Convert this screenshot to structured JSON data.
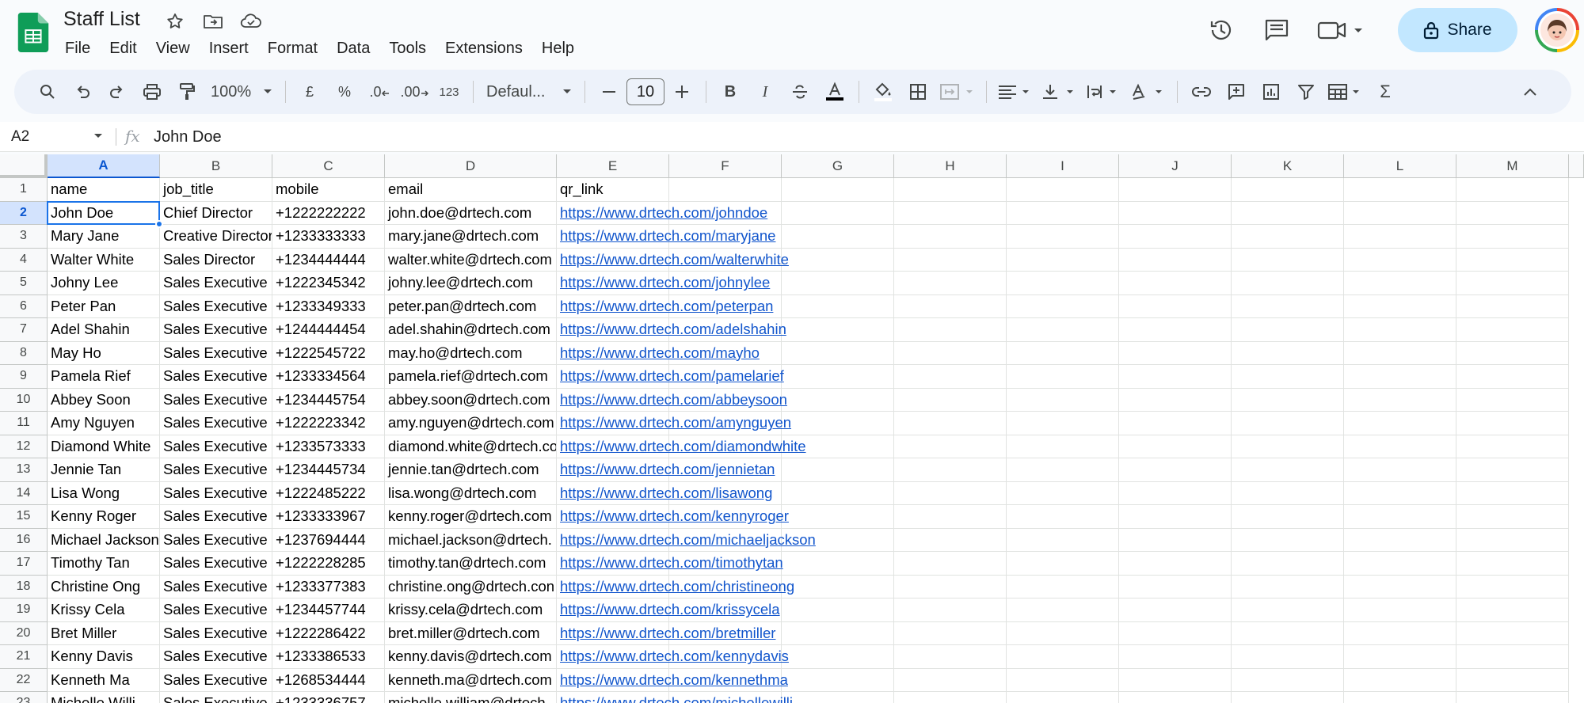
{
  "doc": {
    "title": "Staff List"
  },
  "menu": [
    "File",
    "Edit",
    "View",
    "Insert",
    "Format",
    "Data",
    "Tools",
    "Extensions",
    "Help"
  ],
  "share_label": "Share",
  "toolbar": {
    "zoom": "100%",
    "currency": "£",
    "percent": "%",
    "dec_decrease": ".0",
    "dec_increase": ".00",
    "number_format": "123",
    "font": "Defaul...",
    "font_size": "10"
  },
  "formula": {
    "cell_ref": "A2",
    "fx": "fx",
    "value": "John Doe"
  },
  "columns": [
    "A",
    "B",
    "C",
    "D",
    "E",
    "F",
    "G",
    "H",
    "I",
    "J",
    "K",
    "L",
    "M"
  ],
  "rows": [
    [
      "name",
      "job_title",
      "mobile",
      "email",
      "qr_link"
    ],
    [
      "John Doe",
      "Chief Director",
      "+1222222222",
      "john.doe@drtech.com",
      "https://www.drtech.com/johndoe"
    ],
    [
      "Mary Jane",
      "Creative Director",
      "+1233333333",
      "mary.jane@drtech.com",
      "https://www.drtech.com/maryjane"
    ],
    [
      "Walter White",
      "Sales Director",
      "+1234444444",
      "walter.white@drtech.com",
      "https://www.drtech.com/walterwhite"
    ],
    [
      "Johny Lee",
      "Sales Executive",
      "+1222345342",
      "johny.lee@drtech.com",
      "https://www.drtech.com/johnylee"
    ],
    [
      "Peter Pan",
      "Sales Executive",
      "+1233349333",
      "peter.pan@drtech.com",
      "https://www.drtech.com/peterpan"
    ],
    [
      "Adel Shahin",
      "Sales Executive",
      "+1244444454",
      "adel.shahin@drtech.com",
      "https://www.drtech.com/adelshahin"
    ],
    [
      "May Ho",
      "Sales Executive",
      "+1222545722",
      "may.ho@drtech.com",
      "https://www.drtech.com/mayho"
    ],
    [
      "Pamela Rief",
      "Sales Executive",
      "+1233334564",
      "pamela.rief@drtech.com",
      "https://www.drtech.com/pamelarief"
    ],
    [
      "Abbey Soon",
      "Sales Executive",
      "+1234445754",
      "abbey.soon@drtech.com",
      "https://www.drtech.com/abbeysoon"
    ],
    [
      "Amy Nguyen",
      "Sales Executive",
      "+1222223342",
      "amy.nguyen@drtech.com",
      "https://www.drtech.com/amynguyen"
    ],
    [
      "Diamond White",
      "Sales Executive",
      "+1233573333",
      "diamond.white@drtech.co",
      "https://www.drtech.com/diamondwhite"
    ],
    [
      "Jennie Tan",
      "Sales Executive",
      "+1234445734",
      "jennie.tan@drtech.com",
      "https://www.drtech.com/jennietan"
    ],
    [
      "Lisa Wong",
      "Sales Executive",
      "+1222485222",
      "lisa.wong@drtech.com",
      "https://www.drtech.com/lisawong"
    ],
    [
      "Kenny Roger",
      "Sales Executive",
      "+1233333967",
      "kenny.roger@drtech.com",
      "https://www.drtech.com/kennyroger"
    ],
    [
      "Michael Jackson",
      "Sales Executive",
      "+1237694444",
      "michael.jackson@drtech.",
      "https://www.drtech.com/michaeljackson"
    ],
    [
      "Timothy Tan",
      "Sales Executive",
      "+1222228285",
      "timothy.tan@drtech.com",
      "https://www.drtech.com/timothytan"
    ],
    [
      "Christine Ong",
      "Sales Executive",
      "+1233377383",
      "christine.ong@drtech.con",
      "https://www.drtech.com/christineong"
    ],
    [
      "Krissy Cela",
      "Sales Executive",
      "+1234457744",
      "krissy.cela@drtech.com",
      "https://www.drtech.com/krissycela"
    ],
    [
      "Bret Miller",
      "Sales Executive",
      "+1222286422",
      "bret.miller@drtech.com",
      "https://www.drtech.com/bretmiller"
    ],
    [
      "Kenny Davis",
      "Sales Executive",
      "+1233386533",
      "kenny.davis@drtech.com",
      "https://www.drtech.com/kennydavis"
    ],
    [
      "Kenneth Ma",
      "Sales Executive",
      "+1268534444",
      "kenneth.ma@drtech.com",
      "https://www.drtech.com/kennethma"
    ],
    [
      "Michelle Willi",
      "Sales Executive",
      "+1233336757",
      "michelle.william@drtech.",
      "https://www.drtech.com/michellewilli"
    ]
  ],
  "row_numbers": [
    "1",
    "2",
    "3",
    "4",
    "5",
    "6",
    "7",
    "8",
    "9",
    "10",
    "11",
    "12",
    "13",
    "14",
    "15",
    "16",
    "17",
    "18",
    "19",
    "20",
    "21",
    "22",
    "23"
  ],
  "selected": {
    "row": 2,
    "col": "A"
  },
  "colors": {
    "accent": "#1a73e8",
    "link": "#1155cc",
    "share_bg": "#c2e7ff",
    "toolbar_bg": "#edf2fa"
  }
}
